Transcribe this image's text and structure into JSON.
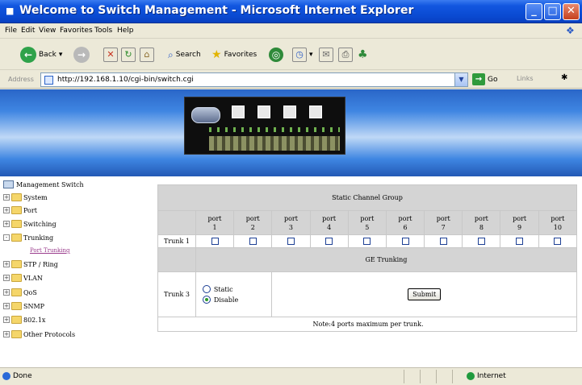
{
  "window": {
    "title": "Welcome to Switch Management - Microsoft Internet Explorer"
  },
  "menu": [
    "File",
    "Edit",
    "View",
    "Favorites",
    "Tools",
    "Help"
  ],
  "toolbar": {
    "back_label": "Back",
    "search_label": "Search",
    "favorites_label": "Favorites"
  },
  "address": {
    "label": "Address",
    "url": "http://192.168.1.10/cgi-bin/switch.cgi",
    "go_label": "Go",
    "links_label": "Links"
  },
  "sidebar": {
    "root": "Management Switch",
    "items": [
      {
        "label": "System",
        "sign": "+"
      },
      {
        "label": "Port",
        "sign": "+"
      },
      {
        "label": "Switching",
        "sign": "+"
      },
      {
        "label": "Trunking",
        "sign": "-"
      },
      {
        "label": "STP / Ring",
        "sign": "+"
      },
      {
        "label": "VLAN",
        "sign": "+"
      },
      {
        "label": "QoS",
        "sign": "+"
      },
      {
        "label": "SNMP",
        "sign": "+"
      },
      {
        "label": "802.1x",
        "sign": "+"
      },
      {
        "label": "Other Protocols",
        "sign": "+"
      }
    ],
    "sub_link": "Port Trunking"
  },
  "main": {
    "static_header": "Static Channel Group",
    "port_word": "port",
    "ports": [
      "1",
      "2",
      "3",
      "4",
      "5",
      "6",
      "7",
      "8",
      "9",
      "10"
    ],
    "trunk1_label": "Trunk 1",
    "ge_header": "GE Trunking",
    "trunk3_label": "Trunk 3",
    "radio_static": "Static",
    "radio_disable": "Disable",
    "selected_option": "Disable",
    "submit_label": "Submit",
    "note": "Note:4 ports maximum per trunk."
  },
  "status": {
    "left": "Done",
    "zone": "Internet"
  }
}
